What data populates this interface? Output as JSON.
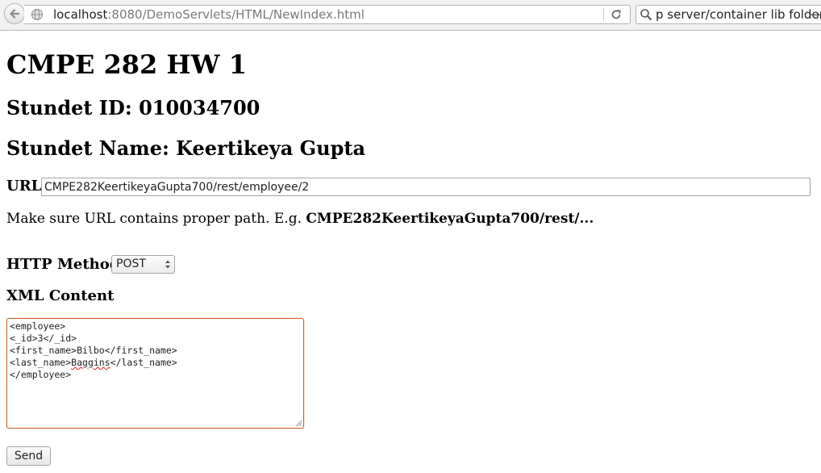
{
  "browser": {
    "url_host": "localhost",
    "url_rest": ":8080/DemoServlets/HTML/NewIndex.html",
    "search_text": "p server/container lib folder.",
    "search_arrow": "→"
  },
  "page": {
    "title": "CMPE 282 HW 1",
    "student_id": "Stundet ID: 010034700",
    "student_name": "Stundet Name: Keertikeya Gupta",
    "url_label": "URL",
    "url_value": "CMPE282KeertikeyaGupta700/rest/employee/2",
    "hint_prefix": "Make sure URL contains proper path. E.g. ",
    "hint_example": "CMPE282KeertikeyaGupta700/rest/...",
    "method_label": "HTTP Method",
    "method_value": "POST",
    "xml_label": "XML Content",
    "xml_lines": {
      "l1": "<employee>",
      "l2": "<_id>3</_id>",
      "l3": "<first_name>Bilbo</first_name>",
      "l4a": "<last_name>",
      "l4b": "Baggins",
      "l4c": "</last_name>",
      "l5": "</employee>"
    },
    "send_label": "Send"
  },
  "icons": {
    "back": "back-arrow-icon",
    "site": "globe-icon",
    "reload": "reload-icon",
    "search": "search-icon",
    "select": "updown-arrows-icon",
    "resize": "resize-grip-icon"
  }
}
